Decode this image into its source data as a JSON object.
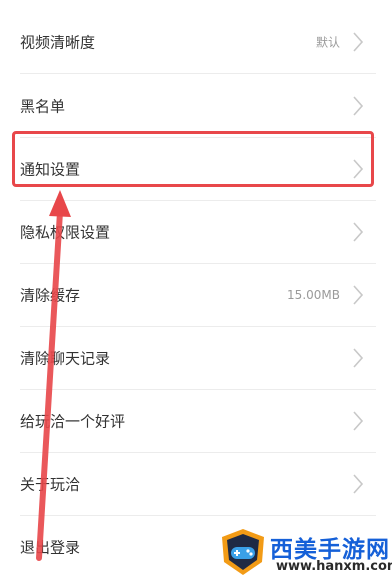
{
  "settings": {
    "items": [
      {
        "label": "视频清晰度",
        "value": "默认"
      },
      {
        "label": "黑名单",
        "value": ""
      },
      {
        "label": "通知设置",
        "value": ""
      },
      {
        "label": "隐私权限设置",
        "value": ""
      },
      {
        "label": "清除缓存",
        "value": "15.00MB"
      },
      {
        "label": "清除聊天记录",
        "value": ""
      },
      {
        "label": "给玩洽一个好评",
        "value": ""
      },
      {
        "label": "关于玩洽",
        "value": ""
      },
      {
        "label": "退出登录",
        "value": ""
      }
    ],
    "chevron_icon": "chevron-right-icon"
  },
  "annotation": {
    "highlight_color": "#e8474a",
    "highlighted_item": "通知设置"
  },
  "watermark": {
    "text": "西美手游网",
    "url": "www.hanxm.com",
    "text_color": "#1560d8"
  }
}
